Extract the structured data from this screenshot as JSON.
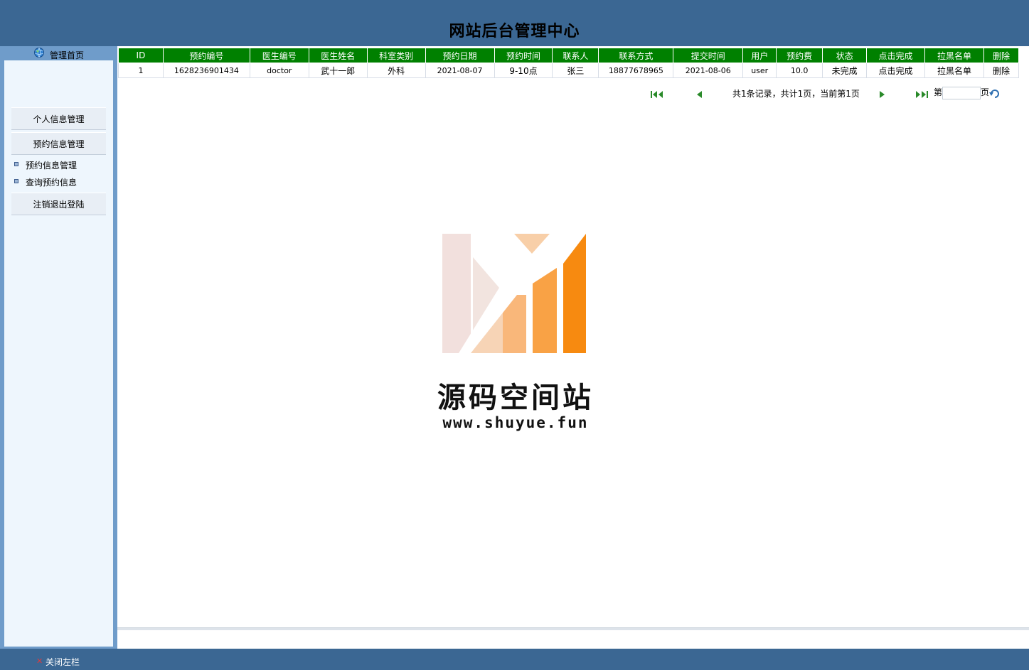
{
  "header": {
    "title": "网站后台管理中心"
  },
  "sidebar": {
    "home_label": "管理首页",
    "menu": [
      {
        "label": "个人信息管理"
      },
      {
        "label": "预约信息管理"
      },
      {
        "label": "注销退出登陆"
      }
    ],
    "sub_items": [
      {
        "label": "预约信息管理"
      },
      {
        "label": "查询预约信息"
      }
    ]
  },
  "table": {
    "columns": [
      "ID",
      "预约编号",
      "医生编号",
      "医生姓名",
      "科室类别",
      "预约日期",
      "预约时间",
      "联系人",
      "联系方式",
      "提交时间",
      "用户",
      "预约费",
      "状态",
      "点击完成",
      "拉黑名单",
      "删除"
    ],
    "rows": [
      [
        "1",
        "1628236901434",
        "doctor",
        "武十一郎",
        "外科",
        "2021-08-07",
        "9-10点",
        "张三",
        "18877678965",
        "2021-08-06",
        "user",
        "10.0",
        "未完成",
        "点击完成",
        "拉黑名单",
        "删除"
      ]
    ]
  },
  "pager": {
    "info": "共1条记录，共计1页，当前第1页",
    "goto_prefix": "第",
    "goto_suffix": "页",
    "goto_value": ""
  },
  "watermark": {
    "name": "源码空间站",
    "url": "www.shuyue.fun"
  },
  "footer": {
    "close_label": "关闭左栏"
  },
  "colors": {
    "header_bg": "#3b6793",
    "sidebar_bg": "#6f9cca",
    "table_header_bg": "#008000"
  }
}
